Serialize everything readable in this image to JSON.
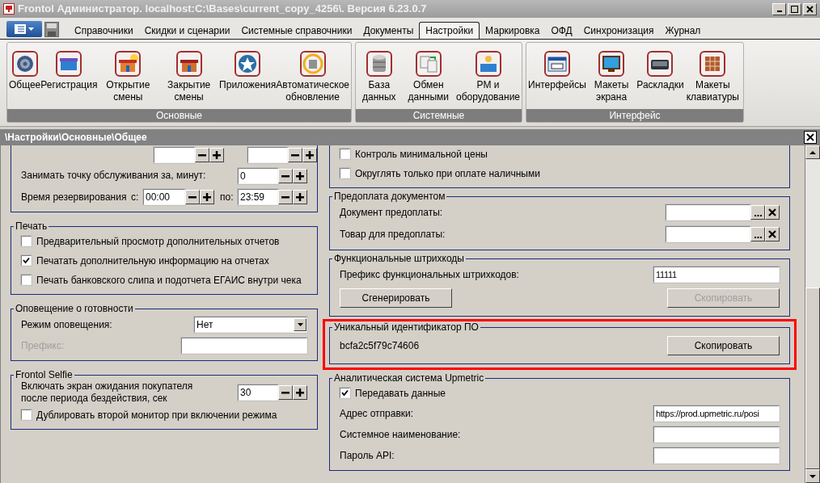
{
  "window": {
    "title": "Frontol Администратор. localhost:C:\\Bases\\current_copy_4256\\. Версия 6.23.0.7"
  },
  "menu_tabs": [
    {
      "label": "Справочники",
      "selected": false
    },
    {
      "label": "Скидки и сценарии",
      "selected": false
    },
    {
      "label": "Системные справочники",
      "selected": false
    },
    {
      "label": "Документы",
      "selected": false
    },
    {
      "label": "Настройки",
      "selected": true
    },
    {
      "label": "Маркировка",
      "selected": false
    },
    {
      "label": "ОФД",
      "selected": false
    },
    {
      "label": "Синхронизация",
      "selected": false
    },
    {
      "label": "Журнал",
      "selected": false
    }
  ],
  "ribbon_groups": [
    {
      "caption": "Основные",
      "items": [
        {
          "label": "Общее",
          "kind": "gear"
        },
        {
          "label": "Регистрация",
          "kind": "register"
        },
        {
          "label": "Открытие смены",
          "kind": "shop_day"
        },
        {
          "label": "Закрытие смены",
          "kind": "shop_night"
        },
        {
          "label": "Приложения",
          "kind": "star"
        },
        {
          "label": "Автоматическое обновление",
          "kind": "update"
        }
      ]
    },
    {
      "caption": "Системные",
      "items": [
        {
          "label": "База данных",
          "kind": "database"
        },
        {
          "label": "Обмен данными",
          "kind": "exchange"
        },
        {
          "label": "РМ и оборудование",
          "kind": "workplace"
        }
      ]
    },
    {
      "caption": "Интерфейс",
      "items": [
        {
          "label": "Интерфейсы",
          "kind": "dialog"
        },
        {
          "label": "Макеты экрана",
          "kind": "monitor"
        },
        {
          "label": "Раскладки",
          "kind": "keyboard"
        },
        {
          "label": "Макеты клавиатуры",
          "kind": "keypad"
        }
      ]
    }
  ],
  "panel": {
    "path": "\\Настройки\\Основные\\Общее"
  },
  "left_groups": [
    {
      "rows": [
        {
          "kind": "spin_pair"
        },
        {
          "kind": "spin",
          "label": "Занимать точку обслуживания за, минут:",
          "value": "0"
        },
        {
          "kind": "time_range",
          "label": "Время резервирования",
          "from_label": "с:",
          "from": "00:00",
          "to_label": "по:",
          "to": "23:59"
        }
      ]
    },
    {
      "title": "Печать",
      "rows": [
        {
          "kind": "checkbox",
          "label": "Предварительный просмотр дополнительных отчетов",
          "checked": false
        },
        {
          "kind": "checkbox",
          "label": "Печатать дополнительную информацию на отчетах",
          "checked": true
        },
        {
          "kind": "checkbox",
          "label": "Печать банковского слипа и подотчета ЕГАИС внутри чека",
          "checked": false
        }
      ]
    },
    {
      "title": "Оповещение о готовности",
      "rows": [
        {
          "kind": "select",
          "label": "Режим оповещения:",
          "value": "Нет"
        },
        {
          "kind": "text",
          "label": "Префикс:",
          "disabled": true
        }
      ]
    },
    {
      "title": "Frontol Selfie",
      "rows": [
        {
          "kind": "spin",
          "label_lines": [
            "Включать экран ожидания покупателя",
            "после периода бездействия, сек"
          ],
          "value": "30"
        },
        {
          "kind": "checkbox",
          "label": "Дублировать второй монитор при включении  режима",
          "checked": false
        }
      ]
    }
  ],
  "right_groups": [
    {
      "rows": [
        {
          "kind": "checkbox",
          "label": "Контроль минимальной цены",
          "checked": false
        },
        {
          "kind": "checkbox",
          "label": "Округлять только при оплате наличными",
          "checked": false
        }
      ]
    },
    {
      "title": "Предоплата документом",
      "rows": [
        {
          "kind": "lookup",
          "label": "Документ предоплаты:"
        },
        {
          "kind": "lookup",
          "label": "Товар для предоплаты:"
        }
      ]
    },
    {
      "title": "Функциональные штрихкоды",
      "rows": [
        {
          "kind": "text",
          "label": "Префикс функциональных штрихкодов:",
          "value": "11111",
          "disabled": false
        },
        {
          "kind": "buttons",
          "buttons": [
            {
              "label": "Сгенерировать",
              "disabled": false
            },
            {
              "label": "Скопировать",
              "disabled": true
            }
          ]
        }
      ]
    },
    {
      "title": "Уникальный идентификатор ПО",
      "highlighted": true,
      "rows": [
        {
          "kind": "id_copy",
          "value": "bcfa2c5f79c74606",
          "button": "Скопировать"
        }
      ]
    },
    {
      "title": "Аналитическая система Upmetric",
      "rows": [
        {
          "kind": "checkbox",
          "label": "Передавать данные",
          "checked": true
        },
        {
          "kind": "text",
          "label": "Адрес отправки:",
          "value": "https://prod.upmetric.ru/posi",
          "disabled": false
        },
        {
          "kind": "text",
          "label": "Системное наименование:",
          "disabled": false
        },
        {
          "kind": "text",
          "label": "Пароль API:",
          "disabled": false
        }
      ]
    }
  ]
}
